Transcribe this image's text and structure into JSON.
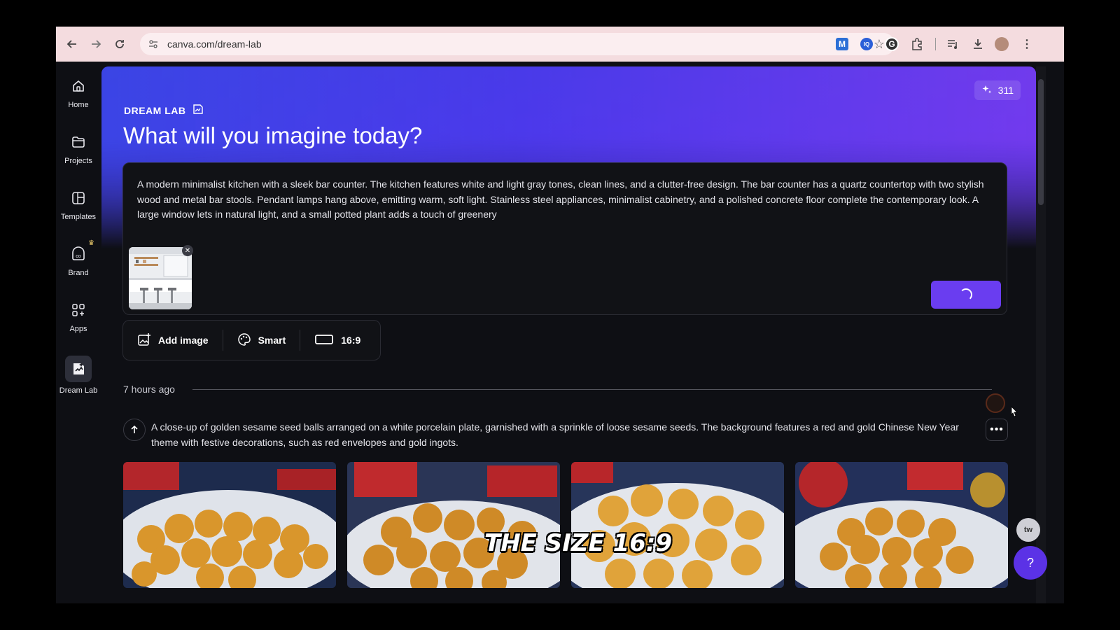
{
  "browser": {
    "url": "canva.com/dream-lab"
  },
  "sidebar": {
    "items": [
      {
        "label": "Home",
        "icon": "home-icon"
      },
      {
        "label": "Projects",
        "icon": "folder-icon"
      },
      {
        "label": "Templates",
        "icon": "templates-icon"
      },
      {
        "label": "Brand",
        "icon": "brand-icon"
      },
      {
        "label": "Apps",
        "icon": "apps-icon"
      },
      {
        "label": "Dream Lab",
        "icon": "dream-lab-icon"
      }
    ]
  },
  "header": {
    "section_label": "DREAM LAB",
    "title": "What will you imagine today?",
    "credits": "311"
  },
  "prompt": {
    "text": "A modern minimalist kitchen with a sleek bar counter. The kitchen features white and light gray tones, clean lines, and a clutter-free design. The bar counter has a quartz countertop with two stylish wood and metal bar stools. Pendant lamps hang above, emitting warm, soft light. Stainless steel appliances, minimalist cabinetry, and a polished concrete floor complete the contemporary look. A large window lets in natural light, and a small potted plant adds a touch of greenery"
  },
  "toolbar": {
    "add_image": "Add image",
    "style": "Smart",
    "aspect": "16:9"
  },
  "history": {
    "timestamp": "7 hours ago",
    "prompt": "A close-up of golden sesame seed balls arranged on a white porcelain plate, garnished with a sprinkle of loose sesame seeds. The background features a red and gold Chinese New Year theme with festive decorations, such as red envelopes and gold ingots."
  },
  "overlay": {
    "caption": "THE SIZE 16:9"
  },
  "help": {
    "label": "?"
  },
  "colors": {
    "accent": "#6a3df0",
    "help": "#5b32e6"
  }
}
